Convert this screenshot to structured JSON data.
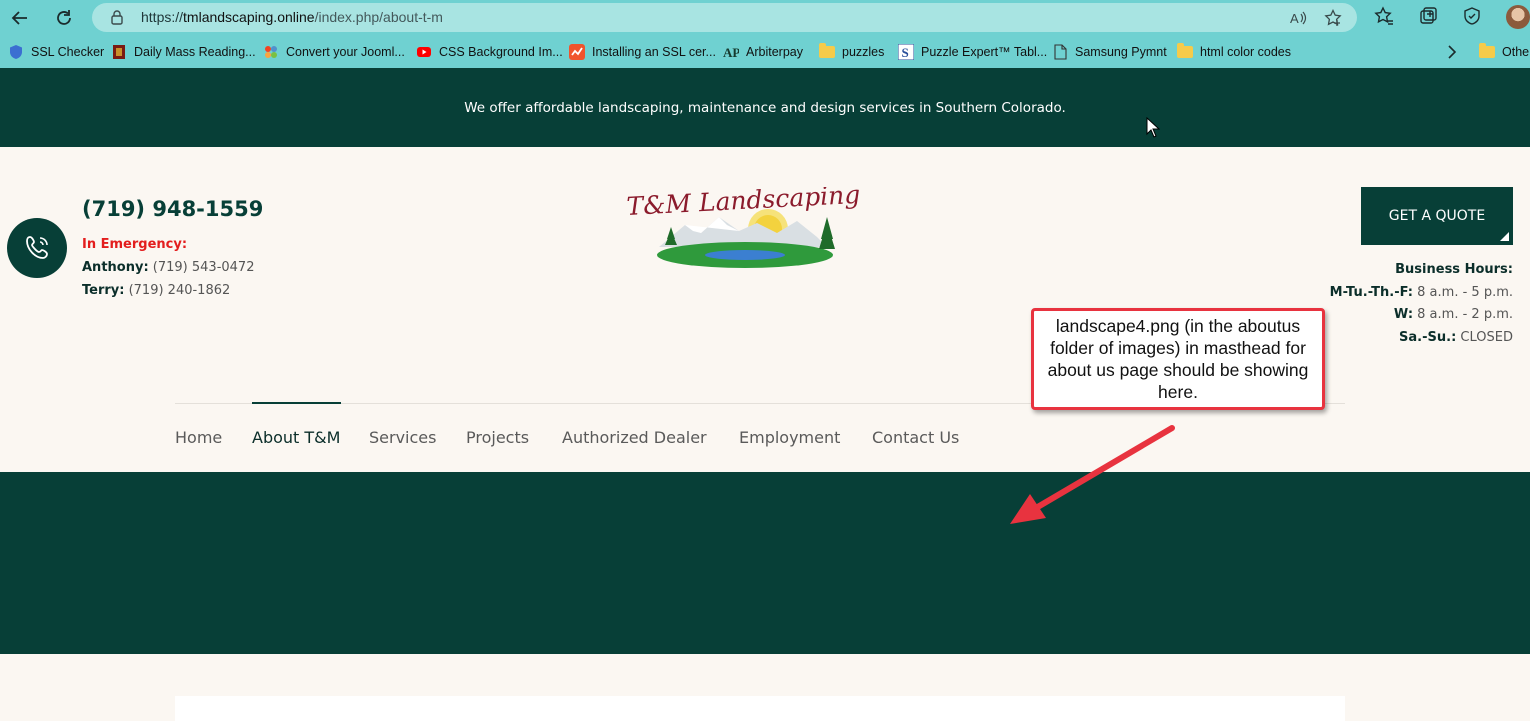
{
  "browser": {
    "url_scheme": "https://",
    "url_host": "tmlandscaping.online",
    "url_path": "/index.php/about-t-m",
    "bookmarks": [
      {
        "label": "SSL Checker",
        "icon": "shield-icon"
      },
      {
        "label": "Daily Mass Reading...",
        "icon": "book-icon"
      },
      {
        "label": "Convert your Jooml...",
        "icon": "joomla-icon"
      },
      {
        "label": "CSS Background Im...",
        "icon": "youtube-icon"
      },
      {
        "label": "Installing an SSL cer...",
        "icon": "chart-icon"
      },
      {
        "label": "Arbiterpay",
        "icon": "ap-icon"
      },
      {
        "label": "puzzles",
        "icon": "folder-icon"
      },
      {
        "label": "Puzzle Expert™ Tabl...",
        "icon": "s-icon"
      },
      {
        "label": "Samsung Pymnt",
        "icon": "page-icon"
      },
      {
        "label": "html color codes",
        "icon": "folder-icon"
      },
      {
        "label": "Othe",
        "icon": "folder-icon"
      }
    ]
  },
  "page": {
    "tagline": "We offer affordable landscaping, maintenance and design services in Southern Colorado.",
    "main_phone": "(719) 948-1559",
    "emergency_label": "In Emergency:",
    "contacts": [
      {
        "name": "Anthony:",
        "phone": "(719) 543-0472"
      },
      {
        "name": "Terry:",
        "phone": "(719) 240-1862"
      }
    ],
    "logo_text": "T&M Landscaping",
    "quote_button": "GET A QUOTE",
    "hours_title": "Business Hours:",
    "hours": [
      {
        "days": "M-Tu.-Th.-F:",
        "time": "8 a.m. - 5 p.m."
      },
      {
        "days": "W:",
        "time": "8 a.m. - 2 p.m."
      },
      {
        "days": "Sa.-Su.:",
        "time": "CLOSED"
      }
    ],
    "nav": [
      "Home",
      "About T&M",
      "Services",
      "Projects",
      "Authorized Dealer",
      "Employment",
      "Contact Us"
    ],
    "nav_active": "About T&M"
  },
  "annotation": {
    "callout_text": "landscape4.png (in the aboutus folder of images) in masthead for about us page should be showing here."
  },
  "colors": {
    "brand_dark_green": "#073f37",
    "page_background": "#fbf7f2",
    "emergency_red": "#e31d1d",
    "browser_teal": "#6fd1d1",
    "callout_red": "#e8333f"
  }
}
